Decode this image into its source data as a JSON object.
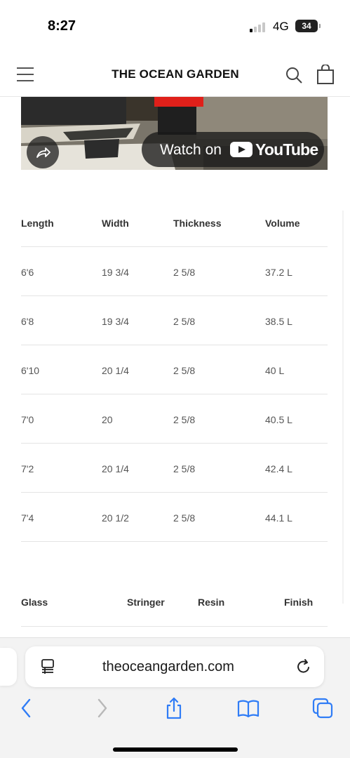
{
  "status_bar": {
    "time": "8:27",
    "network": "4G",
    "battery": "34"
  },
  "header": {
    "brand": "THE OCEAN GARDEN",
    "menu_icon": "hamburger-icon",
    "search_icon": "search-icon",
    "cart_icon": "shopping-bag-icon"
  },
  "video": {
    "watch_label": "Watch on",
    "platform": "YouTube",
    "share_icon": "share-arrow-icon"
  },
  "specs": {
    "columns": [
      "Length",
      "Width",
      "Thickness",
      "Volume"
    ],
    "rows": [
      [
        "6'6",
        "19 3/4",
        "2 5/8",
        "37.2 L"
      ],
      [
        "6'8",
        "19 3/4",
        "2 5/8",
        "38.5 L"
      ],
      [
        "6'10",
        "20 1/4",
        "2 5/8",
        "40 L"
      ],
      [
        "7'0",
        "20",
        "2 5/8",
        "40.5 L"
      ],
      [
        "7'2",
        "20 1/4",
        "2 5/8",
        "42.4 L"
      ],
      [
        "7'4",
        "20 1/2",
        "2 5/8",
        "44.1 L"
      ]
    ]
  },
  "specs2": {
    "columns": [
      "Glass",
      "Stringer",
      "Resin",
      "Finish"
    ]
  },
  "browser": {
    "url": "theoceangarden.com",
    "icons": [
      "reader-mode-icon",
      "reload-icon",
      "back-icon",
      "forward-icon",
      "share-icon",
      "bookmarks-icon",
      "tabs-icon"
    ]
  },
  "colors": {
    "ios_blue": "#2f7cf6",
    "ios_gray": "#b8b8b8",
    "text": "#1a1a1a"
  }
}
